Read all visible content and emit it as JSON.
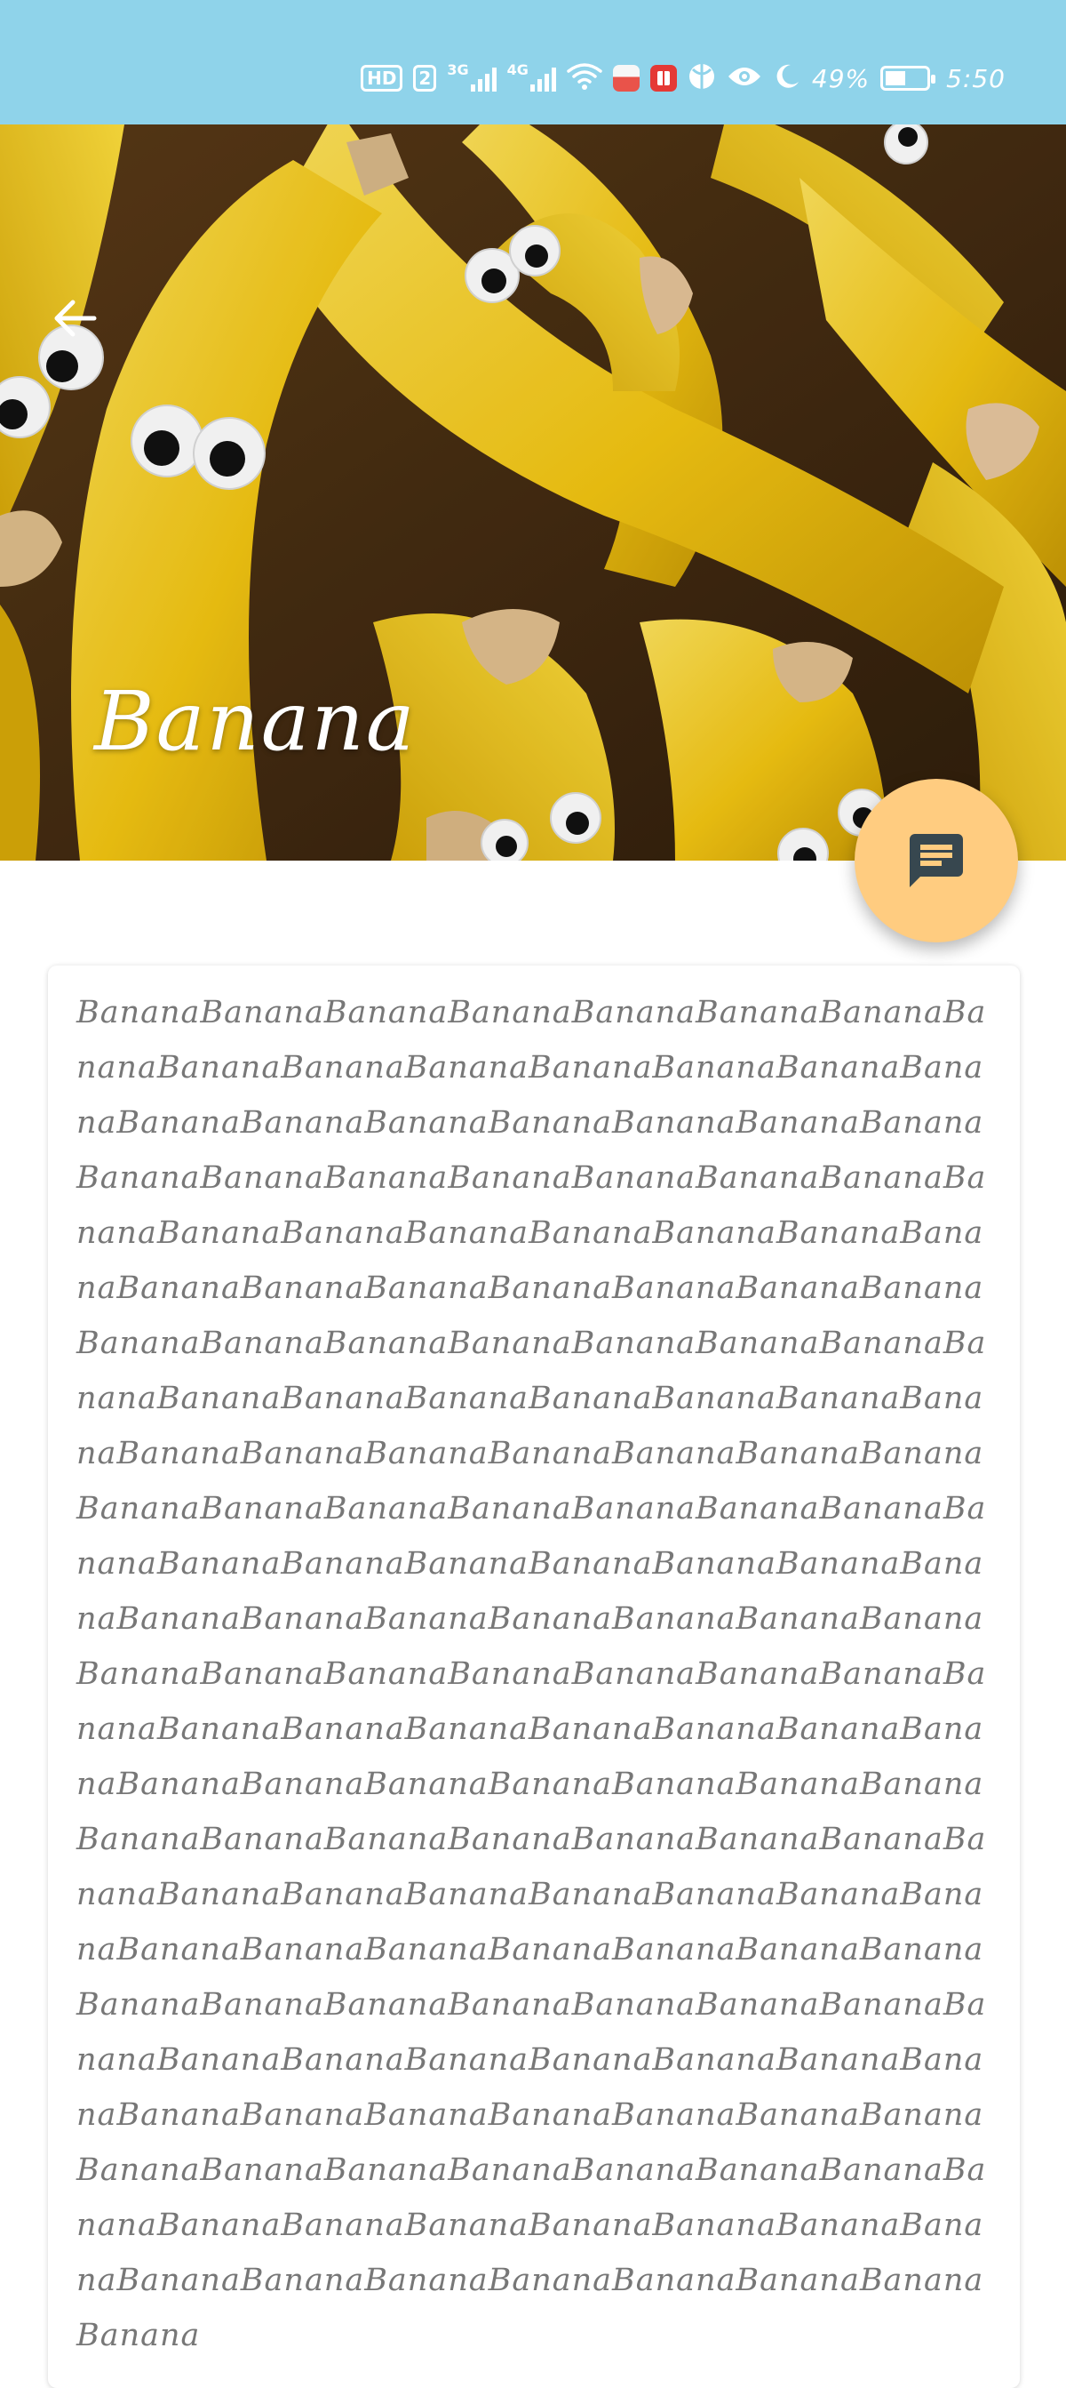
{
  "status_bar": {
    "hd_label": "HD",
    "sim_label": "2",
    "net1_label": "3G",
    "net2_label": "4G",
    "battery_text": "49%",
    "battery_level": 0.49,
    "time": "5:50",
    "icons": [
      "hd-icon",
      "signal-3g-icon",
      "signal-4g-icon",
      "wifi-icon",
      "app-notification-icon",
      "book-notification-icon",
      "ball-notification-icon",
      "eye-icon",
      "moon-icon",
      "battery-icon"
    ]
  },
  "hero": {
    "title": "Banana",
    "back_icon": "arrow-back-icon"
  },
  "fab": {
    "icon": "chat-message-icon",
    "color": "#ffcc80"
  },
  "content": {
    "body": "BananaBananaBananaBananaBananaBananaBananaBananaBananaBananaBananaBananaBananaBananaBananaBananaBananaBananaBananaBananaBananaBananaBananaBananaBananaBananaBananaBananaBananaBananaBananaBananaBananaBananaBananaBananaBananaBananaBananaBananaBananaBananaBananaBananaBananaBananaBananaBananaBananaBananaBananaBananaBananaBananaBananaBananaBananaBananaBananaBananaBananaBananaBananaBananaBananaBananaBananaBananaBananaBananaBananaBananaBananaBananaBananaBananaBananaBananaBananaBananaBananaBananaBananaBananaBananaBananaBananaBananaBananaBananaBananaBananaBananaBananaBananaBananaBananaBananaBananaBananaBananaBananaBananaBananaBananaBananaBananaBananaBananaBananaBananaBananaBananaBananaBananaBananaBananaBananaBananaBananaBananaBananaBananaBananaBananaBananaBananaBananaBananaBananaBananaBananaBananaBananaBananaBananaBananaBananaBananaBananaBananaBananaBananaBananaBananaBananaBananaBananaBananaBananaBananaBananaBananaBananaBananaBananaBananaBananaBananaBananaBananaBananaBananaBananaBananaBananaBananaBananaBananaBananaBananaBananaBananaBananaBananaBananaBanana"
  },
  "colors": {
    "status_bar": "#8fd3ea",
    "fab": "#ffcc80",
    "body_text": "#777777"
  }
}
